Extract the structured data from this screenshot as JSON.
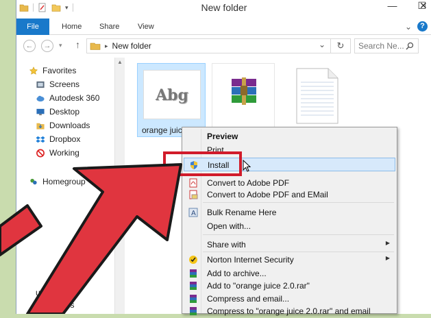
{
  "window": {
    "title": "New folder",
    "controls": {
      "minimize": "—",
      "maximize": "☐",
      "close": "✕"
    }
  },
  "ribbon": {
    "tabs": [
      "File",
      "Home",
      "Share",
      "View"
    ],
    "expand_glyph": "⌄",
    "help_glyph": "?"
  },
  "address": {
    "back_glyph": "←",
    "forward_glyph": "→",
    "up_glyph": "↑",
    "path": "New folder",
    "dropdown_glyph": "⌄",
    "refresh_glyph": "↻",
    "search_placeholder": "Search Ne..."
  },
  "nav": {
    "favorites_label": "Favorites",
    "items": [
      "Screens",
      "Autodesk 360",
      "Desktop",
      "Downloads",
      "Dropbox",
      "Working"
    ],
    "homegroup_label": "Homegroup",
    "partial_items": [
      "ures",
      "Videos"
    ]
  },
  "files": {
    "selected_name": "orange juice",
    "font_preview_text": "Abg"
  },
  "context_menu": {
    "items": [
      {
        "label": "Preview",
        "bold": true
      },
      {
        "label": "Print"
      },
      {
        "label": "Install",
        "highlighted": true
      },
      {
        "label": "Convert to Adobe PDF"
      },
      {
        "label": "Convert to Adobe PDF and EMail"
      },
      {
        "label": "Bulk Rename Here"
      },
      {
        "label": "Open with..."
      },
      {
        "label": "Share with",
        "submenu": true
      },
      {
        "label": "Norton Internet Security",
        "submenu": true
      },
      {
        "label": "Add to archive..."
      },
      {
        "label": "Add to \"orange juice 2.0.rar\""
      },
      {
        "label": "Compress and email..."
      },
      {
        "label": "Compress to \"orange juice 2.0.rar\" and email"
      }
    ]
  },
  "colors": {
    "accent": "#1979ca",
    "annotation_red": "#d11b2a",
    "selection": "#cce8ff"
  }
}
